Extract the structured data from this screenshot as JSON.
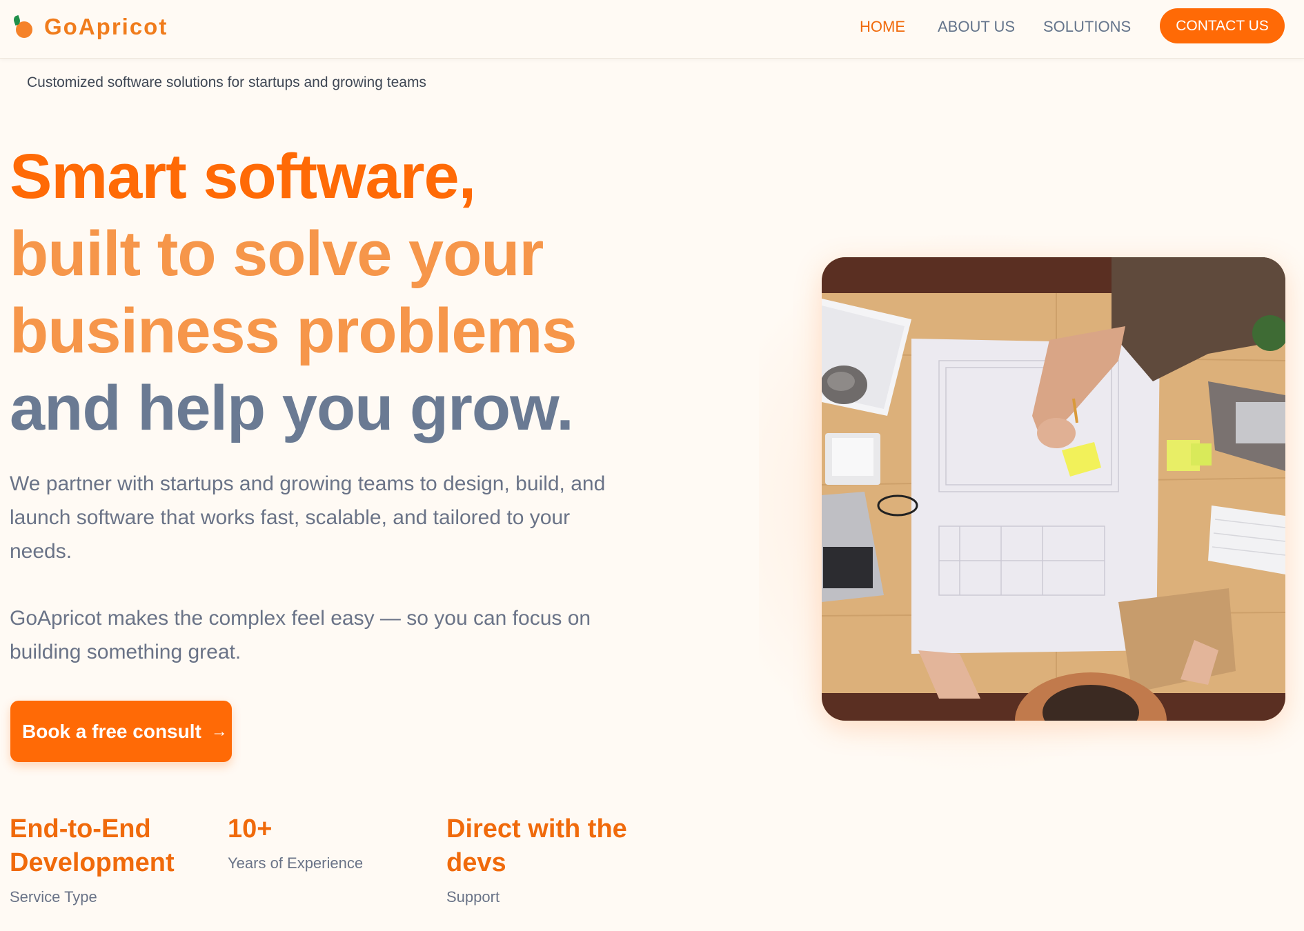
{
  "brand": {
    "name": "GoApricot",
    "primary_color": "#ff6a06",
    "logo_icon": "apricot-icon"
  },
  "nav": {
    "items": [
      {
        "label": "HOME",
        "active": true
      },
      {
        "label": "ABOUT US",
        "active": false
      },
      {
        "label": "SOLUTIONS",
        "active": false
      }
    ],
    "contact_label": "CONTACT US"
  },
  "hero": {
    "tagline": "Customized software solutions for startups and growing teams",
    "headline": [
      "Smart software,",
      "built to solve your",
      "business problems",
      "and help you grow."
    ],
    "paragraph1": "We partner with startups and growing teams to design, build, and launch software that works fast, scalable, and tailored to your needs.",
    "paragraph2": "GoApricot makes the complex feel easy — so you can focus on building something great.",
    "cta_label": "Book a free consult",
    "cta_icon": "arrow-right-icon"
  },
  "stats": [
    {
      "value": "End-to-End Development",
      "label": "Service Type"
    },
    {
      "value": "10+",
      "label": "Years of Experience"
    },
    {
      "value": "Direct with the devs",
      "label": "Support"
    }
  ]
}
